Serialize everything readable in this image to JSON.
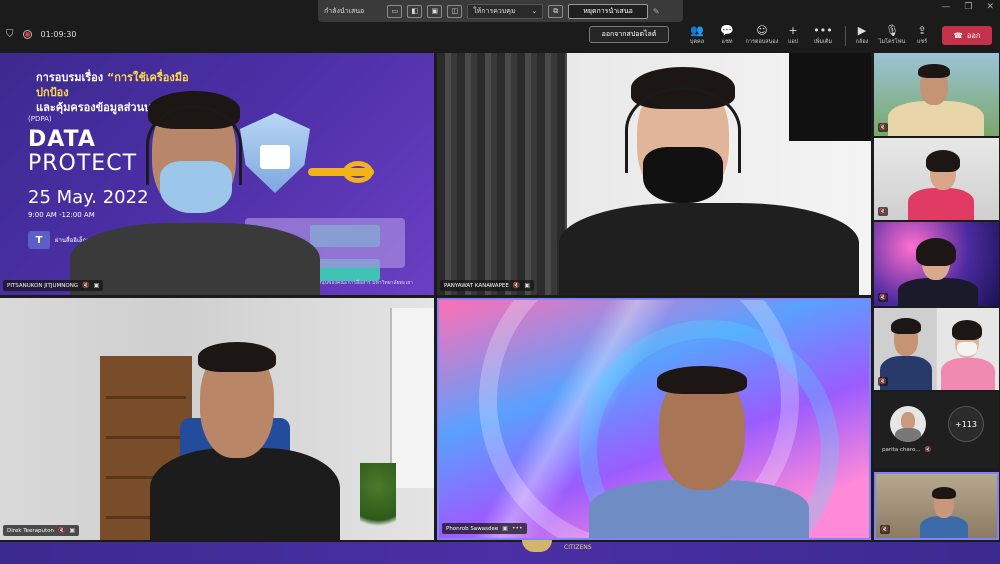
{
  "share_banner": {
    "status_label": "กำลังนำเสนอ",
    "control_dropdown": "ให้การควบคุม",
    "stop_button": "หยุดการนำเสนอ"
  },
  "meeting": {
    "timer": "01:09:30",
    "exit_presenter_view": "ออกจากสปอตไลต์",
    "toolbar": [
      {
        "icon": "people-icon",
        "label": "บุคคล"
      },
      {
        "icon": "chat-icon",
        "label": "แชท"
      },
      {
        "icon": "react-icon",
        "label": "การตอบสนอง"
      },
      {
        "icon": "plus-icon",
        "label": "แอป"
      },
      {
        "icon": "more-icon",
        "label": "เพิ่มเติม"
      }
    ],
    "media": [
      {
        "icon": "camera-icon",
        "label": "กล้อง"
      },
      {
        "icon": "mic-icon",
        "label": "ไมโครโฟน"
      },
      {
        "icon": "share-icon",
        "label": "แชร์"
      }
    ],
    "leave_label": "ออก"
  },
  "slide": {
    "title_line1_prefix": "การอบรมเรื่อง ",
    "title_line1_quote": "“การใช้เครื่องมือปกป้อง",
    "title_line2": "และคุ้มครองข้อมูลส่วนบุคคล",
    "pdpa": "(PDPA)",
    "word1": "DATA",
    "word2": "PROTECT",
    "date": "25 May. 2022",
    "time": "9:00 AM -12:00 AM",
    "channel": "ผ่านสื่ออิเล็กทรอนิกส์",
    "footer": "การสนับสนุนของคณะการสื่อสาร มหาวิทยาลัยพะเยา"
  },
  "tiles": [
    {
      "name": "PITSANUKON JITJUMNONG"
    },
    {
      "name": "PANYAWAT KANAWAPEE"
    },
    {
      "name": "Direk Teeraputon"
    },
    {
      "name": "Phonrob Sawasdee"
    }
  ],
  "gallery": {
    "labeled_name": "parita charo...",
    "more_count": "+113"
  },
  "bottom": {
    "text": "CITIZENS"
  }
}
